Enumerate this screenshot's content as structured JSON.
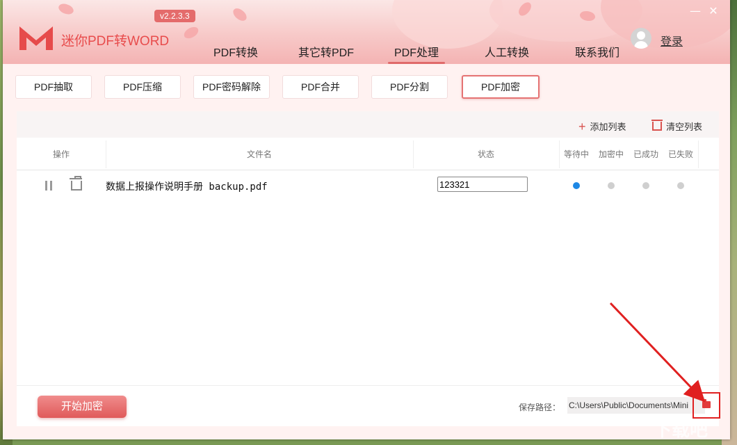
{
  "app": {
    "title": "迷你PDF转WORD",
    "version": "v2.2.3.3",
    "login": "登录",
    "minimize": "—",
    "close": "✕"
  },
  "nav": [
    "PDF转换",
    "其它转PDF",
    "PDF处理",
    "人工转换",
    "联系我们"
  ],
  "nav_active": "PDF处理",
  "subtabs": [
    "PDF抽取",
    "PDF压缩",
    "PDF密码解除",
    "PDF合并",
    "PDF分割",
    "PDF加密"
  ],
  "subtab_active": "PDF加密",
  "toolbar": {
    "add": "添加列表",
    "clear": "清空列表"
  },
  "table": {
    "headers": [
      "操作",
      "文件名",
      "状态",
      "等待中",
      "加密中",
      "已成功",
      "已失败"
    ],
    "rows": [
      {
        "filename": "数据上报操作说明手册 backup.pdf",
        "password": "123321",
        "status_active": "等待中"
      }
    ]
  },
  "footer": {
    "start": "开始加密",
    "save_label": "保存路径：",
    "save_path": "C:\\Users\\Public\\Documents\\Mini"
  },
  "watermark": "下载吧",
  "colors": {
    "accent": "#e05a5a",
    "active_dot": "#1e88e5",
    "highlight": "#e02020"
  }
}
